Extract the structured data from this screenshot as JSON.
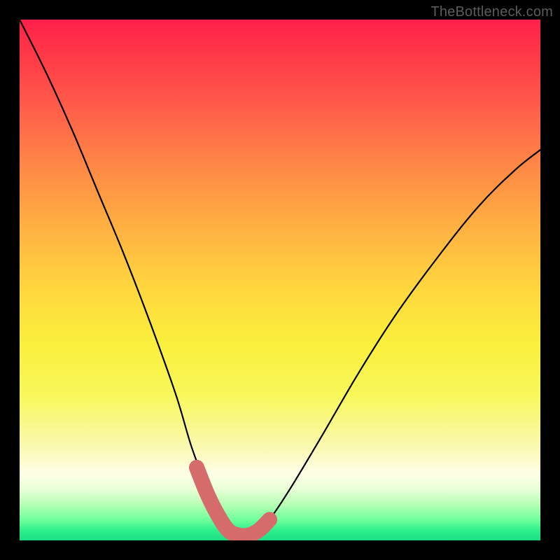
{
  "watermark": "TheBottleneck.com",
  "chart_data": {
    "type": "line",
    "title": "",
    "xlabel": "",
    "ylabel": "",
    "xlim": [
      0,
      100
    ],
    "ylim": [
      0,
      100
    ],
    "grid": false,
    "legend": false,
    "series": [
      {
        "name": "bottleneck-curve",
        "x": [
          0,
          5,
          10,
          15,
          20,
          25,
          30,
          33,
          36,
          38,
          40,
          42,
          44,
          46,
          48,
          52,
          58,
          65,
          72,
          80,
          88,
          95,
          100
        ],
        "y": [
          100,
          90,
          79,
          67,
          55,
          42,
          28,
          18,
          10,
          5,
          2,
          1,
          1,
          2,
          4,
          10,
          20,
          32,
          43,
          54,
          64,
          71,
          75
        ]
      }
    ],
    "marker": {
      "name": "recommended-range",
      "x": [
        34,
        36,
        38,
        40,
        42,
        44,
        46,
        48
      ],
      "y": [
        14,
        9,
        5,
        2,
        1,
        1,
        2,
        4
      ],
      "color": "#d66b6b"
    }
  },
  "colors": {
    "background": "#000000",
    "curve": "#000000",
    "marker": "#d66b6b",
    "watermark": "#5c5c5c"
  }
}
